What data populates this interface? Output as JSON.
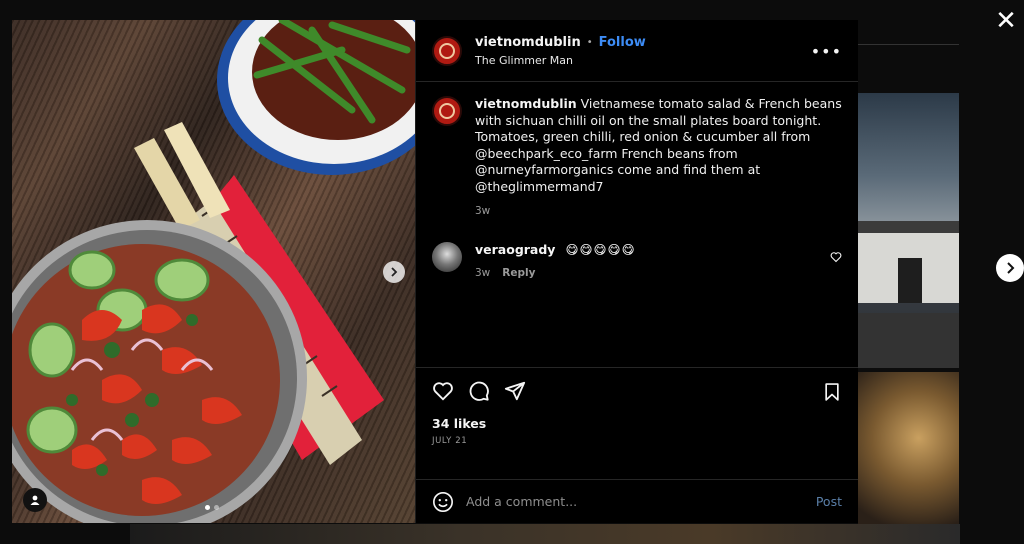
{
  "header": {
    "username": "vietnomdublin",
    "bullet": "•",
    "follow_label": "Follow",
    "location": "The Glimmer Man",
    "more_label": "•••"
  },
  "caption": {
    "username": "vietnomdublin",
    "text": "Vietnamese tomato salad & French beans with sichuan chilli oil on the small plates board tonight. Tomatoes, green chilli, red onion & cucumber all from @beechpark_eco_farm French beans from @nurneyfarmorganics come and find them at @theglimmermand7",
    "age": "3w"
  },
  "comments": [
    {
      "username": "veraogrady",
      "text": "😋😋😋😋😋",
      "age": "3w",
      "reply_label": "Reply"
    }
  ],
  "stats": {
    "likes": "34 likes",
    "date": "JULY 21"
  },
  "add_comment": {
    "placeholder": "Add a comment...",
    "post_label": "Post"
  },
  "controls": {
    "close_label": "✕"
  },
  "icons": {
    "like": "heart-icon",
    "comment": "comment-icon",
    "share": "share-icon",
    "save": "bookmark-icon",
    "emoji": "smiley-icon",
    "tag": "user-tag-icon",
    "next": "chevron-right-icon"
  },
  "colors": {
    "follow": "#3d8cf5",
    "avatar": "#b01a12",
    "background": "#000000"
  }
}
